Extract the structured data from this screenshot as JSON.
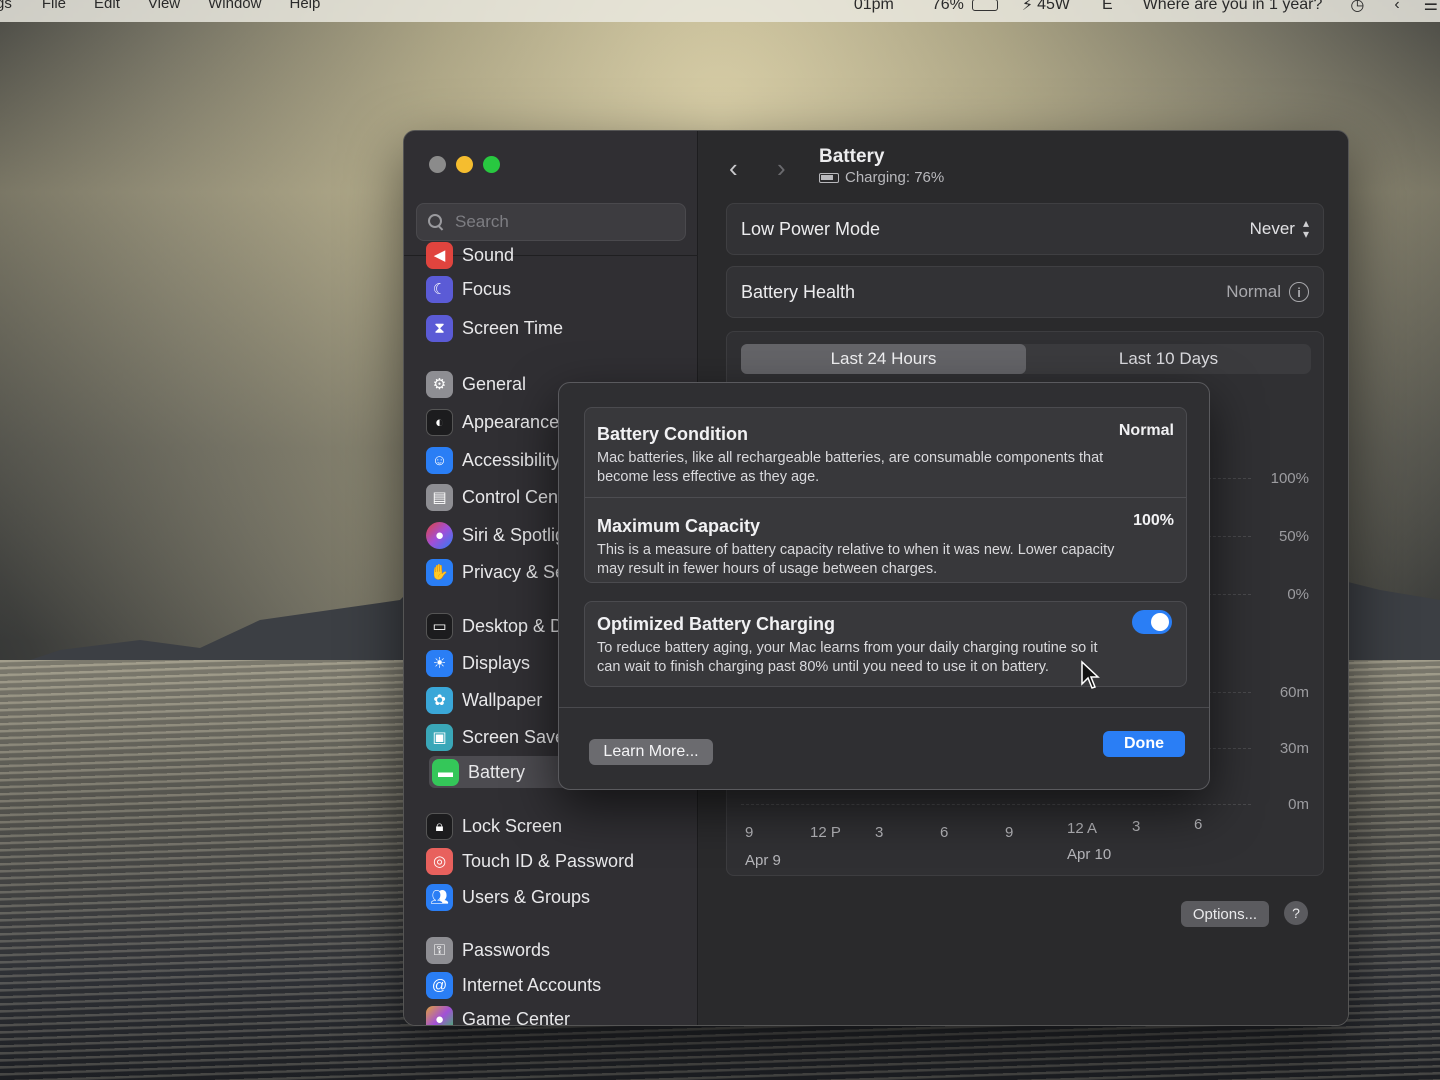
{
  "menubar": {
    "left_items": [
      "gs",
      "File",
      "Edit",
      "View",
      "Window",
      "Help"
    ],
    "status_items": [
      "01pm",
      "76%",
      "45W",
      "E"
    ],
    "prompt": "Where are you in 1 year?"
  },
  "sidebar": {
    "search_placeholder": "Search",
    "items": [
      {
        "label": "Sound",
        "icon": "speaker-icon",
        "color": "#e0443e"
      },
      {
        "label": "Focus",
        "icon": "moon-icon",
        "color": "#5b5bd6"
      },
      {
        "label": "Screen Time",
        "icon": "hourglass-icon",
        "color": "#5b5bd6"
      },
      {
        "label": "General",
        "icon": "gear-icon",
        "color": "#8e8e93"
      },
      {
        "label": "Appearance",
        "icon": "appearance-icon",
        "color": "#1c1c1e"
      },
      {
        "label": "Accessibility",
        "icon": "accessibility-icon",
        "color": "#2a7ef5"
      },
      {
        "label": "Control Centre",
        "icon": "control-centre-icon",
        "color": "#8e8e93"
      },
      {
        "label": "Siri & Spotlight",
        "icon": "siri-icon",
        "color": "#a14fd8"
      },
      {
        "label": "Privacy & Security",
        "icon": "hand-icon",
        "color": "#2a7ef5"
      },
      {
        "label": "Desktop & Dock",
        "icon": "dock-icon",
        "color": "#1c1c1e"
      },
      {
        "label": "Displays",
        "icon": "sun-icon",
        "color": "#2a7ef5"
      },
      {
        "label": "Wallpaper",
        "icon": "flower-icon",
        "color": "#3aa7d8"
      },
      {
        "label": "Screen Saver",
        "icon": "screensaver-icon",
        "color": "#3aa7b8"
      },
      {
        "label": "Battery",
        "icon": "battery-icon",
        "color": "#34c759"
      },
      {
        "label": "Lock Screen",
        "icon": "lock-icon",
        "color": "#1c1c1e"
      },
      {
        "label": "Touch ID & Password",
        "icon": "fingerprint-icon",
        "color": "#e8615d"
      },
      {
        "label": "Users & Groups",
        "icon": "users-icon",
        "color": "#2a7ef5"
      },
      {
        "label": "Passwords",
        "icon": "key-icon",
        "color": "#8e8e93"
      },
      {
        "label": "Internet Accounts",
        "icon": "at-icon",
        "color": "#2a7ef5"
      },
      {
        "label": "Game Center",
        "icon": "game-center-icon",
        "color": "#e0a03e"
      }
    ]
  },
  "content": {
    "title": "Battery",
    "subtitle": "Charging: 76%",
    "low_power_label": "Low Power Mode",
    "low_power_value": "Never",
    "health_label": "Battery Health",
    "health_value": "Normal",
    "tabs": [
      "Last 24 Hours",
      "Last 10 Days"
    ],
    "y_labels_level": [
      "100%",
      "50%",
      "0%"
    ],
    "y_labels_usage": [
      "60m",
      "30m",
      "0m"
    ],
    "x_labels": [
      "9",
      "12 P",
      "3",
      "6",
      "9",
      "12 A",
      "3",
      "6"
    ],
    "date_labels": [
      "Apr 9",
      "Apr 10"
    ],
    "options_label": "Options...",
    "help_label": "?"
  },
  "dialog": {
    "condition_title": "Battery Condition",
    "condition_value": "Normal",
    "condition_desc": "Mac batteries, like all rechargeable batteries, are consumable components that become less effective as they age.",
    "capacity_title": "Maximum Capacity",
    "capacity_value": "100%",
    "capacity_desc": "This is a measure of battery capacity relative to when it was new. Lower capacity may result in fewer hours of usage between charges.",
    "optimized_title": "Optimized Battery Charging",
    "optimized_desc": "To reduce battery aging, your Mac learns from your daily charging routine so it can wait to finish charging past 80% until you need to use it on battery.",
    "learn_more": "Learn More...",
    "done": "Done"
  }
}
